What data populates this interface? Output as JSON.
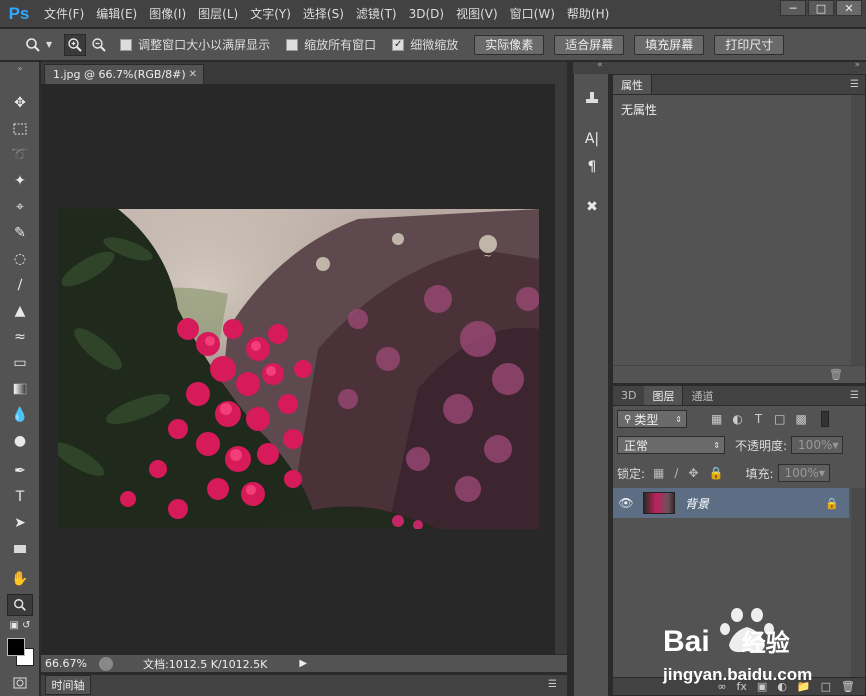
{
  "app": {
    "logo": "Ps"
  },
  "menu": [
    "文件(F)",
    "编辑(E)",
    "图像(I)",
    "图层(L)",
    "文字(Y)",
    "选择(S)",
    "滤镜(T)",
    "3D(D)",
    "视图(V)",
    "窗口(W)",
    "帮助(H)"
  ],
  "options": {
    "resize_windows": "调整窗口大小以满屏显示",
    "zoom_all": "缩放所有窗口",
    "scrubby_zoom": "细微缩放",
    "scrubby_checked": true,
    "actual_pixels": "实际像素",
    "fit_screen": "适合屏幕",
    "fill_screen": "填充屏幕",
    "print_size": "打印尺寸"
  },
  "document": {
    "tab_title": "1.jpg @ 66.7%(RGB/8#)",
    "zoom": "66.67%",
    "doc_info": "文档:1012.5 K/1012.5K"
  },
  "timeline": {
    "label": "时间轴"
  },
  "properties": {
    "tab": "属性",
    "content": "无属性"
  },
  "layers": {
    "tabs": [
      "3D",
      "图层",
      "通道"
    ],
    "filter_kind": "类型",
    "blend_mode": "正常",
    "opacity_label": "不透明度:",
    "opacity_value": "100%",
    "lock_label": "锁定:",
    "fill_label": "填充:",
    "fill_value": "100%",
    "layer_name": "背景"
  },
  "watermark": {
    "brand_text": "Bai",
    "brand_text2": "经验",
    "url": "jingyan.baidu.com"
  },
  "colors": {
    "ps_blue": "#31a8ff",
    "selected_layer": "#5c6d84",
    "panel": "#535353"
  }
}
